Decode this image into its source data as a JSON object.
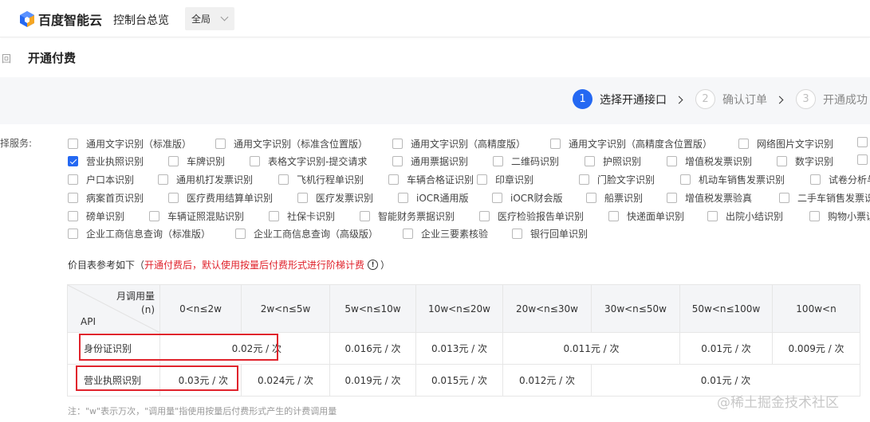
{
  "header": {
    "brand": "百度智能云",
    "console_title": "控制台总览",
    "region": "全局"
  },
  "page": {
    "back_char": "回",
    "title": "开通付费"
  },
  "steps": [
    {
      "num": "1",
      "label": "选择开通接口",
      "state": "active"
    },
    {
      "num": "2",
      "label": "确认订单",
      "state": "inactive"
    },
    {
      "num": "3",
      "label": "开通成功",
      "state": "inactive"
    }
  ],
  "services_label": "择服务:",
  "services": [
    {
      "label": "通用文字识别（标准版）",
      "checked": false
    },
    {
      "label": "通用文字识别（标准含位置版）",
      "checked": false
    },
    {
      "label": "通用文字识别（高精度版）",
      "checked": false
    },
    {
      "label": "通用文字识别（高精度含位置版）",
      "checked": false
    },
    {
      "label": "网络图片文字识别",
      "checked": false
    },
    {
      "label": "",
      "checked": false
    },
    {
      "label": "营业执照识别",
      "checked": true
    },
    {
      "label": "车牌识别",
      "checked": false
    },
    {
      "label": "表格文字识别-提交请求",
      "checked": false
    },
    {
      "label": "通用票据识别",
      "checked": false
    },
    {
      "label": "二维码识别",
      "checked": false
    },
    {
      "label": "护照识别",
      "checked": false
    },
    {
      "label": "增值税发票识别",
      "checked": false
    },
    {
      "label": "数字识别",
      "checked": false
    },
    {
      "label": "",
      "checked": false
    },
    {
      "label": "户口本识别",
      "checked": false
    },
    {
      "label": "通用机打发票识别",
      "checked": false
    },
    {
      "label": "飞机行程单识别",
      "checked": false
    },
    {
      "label": "车辆合格证识别",
      "checked": false
    },
    {
      "label": "印章识别",
      "checked": false
    },
    {
      "label": "门脸文字识别",
      "checked": false
    },
    {
      "label": "机动车销售发票识别",
      "checked": false
    },
    {
      "label": "试卷分析与",
      "checked": false
    },
    {
      "label": "病案首页识别",
      "checked": false
    },
    {
      "label": "医疗费用结算单识别",
      "checked": false
    },
    {
      "label": "医疗发票识别",
      "checked": false
    },
    {
      "label": "iOCR通用版",
      "checked": false
    },
    {
      "label": "iOCR财会版",
      "checked": false
    },
    {
      "label": "船票识别",
      "checked": false
    },
    {
      "label": "增值税发票验真",
      "checked": false
    },
    {
      "label": "二手车销售发票识",
      "checked": false
    },
    {
      "label": "磅单识别",
      "checked": false
    },
    {
      "label": "车辆证照混贴识别",
      "checked": false
    },
    {
      "label": "社保卡识别",
      "checked": false
    },
    {
      "label": "智能财务票据识别",
      "checked": false
    },
    {
      "label": "医疗检验报告单识别",
      "checked": false
    },
    {
      "label": "快递面单识别",
      "checked": false
    },
    {
      "label": "出院小结识别",
      "checked": false
    },
    {
      "label": "购物小票识",
      "checked": false
    },
    {
      "label": "企业工商信息查询（标准版）",
      "checked": false
    },
    {
      "label": "企业工商信息查询（高级版）",
      "checked": false
    },
    {
      "label": "企业三要素核验",
      "checked": false
    },
    {
      "label": "银行回单识别",
      "checked": false
    }
  ],
  "price_note": {
    "prefix": "价目表参考如下（",
    "highlight": "开通付费后，默认使用按量后付费形式进行阶梯计费",
    "info_symbol": "!",
    "suffix": "）"
  },
  "price_table": {
    "corner_top": "月调用量",
    "corner_unit": "(n)",
    "corner_bottom": "API",
    "columns": [
      "0<n≤2w",
      "2w<n≤5w",
      "5w<n≤10w",
      "10w<n≤20w",
      "20w<n≤30w",
      "30w<n≤50w",
      "50w<n≤100w",
      "100w<n"
    ],
    "rows": [
      {
        "name": "身份证识别",
        "cells": [
          "0.02元 / 次",
          "0.016元 / 次",
          "0.013元 / 次",
          "0.011元 / 次",
          "0.01元 / 次",
          "0.009元 / 次"
        ]
      },
      {
        "name": "营业执照识别",
        "cells": [
          "0.03元 / 次",
          "0.024元 / 次",
          "0.019元 / 次",
          "0.015元 / 次",
          "0.012元 / 次",
          "0.01元 / 次"
        ]
      }
    ]
  },
  "footnote": "注：\"w\"表示万次，\"调用量\"指使用按量后付费形式产生的计费调用量",
  "watermark": "@稀土掘金技术社区",
  "colors": {
    "accent": "#2468f2",
    "highlight_red": "#e0232c"
  }
}
